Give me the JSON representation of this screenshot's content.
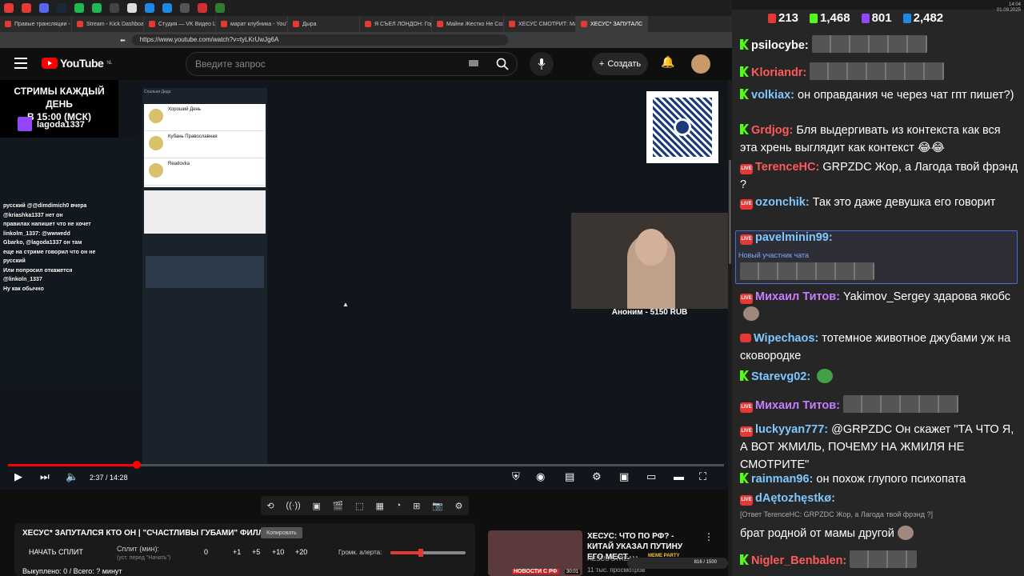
{
  "browser": {
    "tabs": [
      {
        "label": "Правые трансляции - Y",
        "active": false
      },
      {
        "label": "Stream - Kick Dashboard",
        "active": false
      },
      {
        "label": "Студия — VK Видео Live",
        "active": false
      },
      {
        "label": "марат клубника - YouTu",
        "active": false
      },
      {
        "label": "Дырa",
        "active": false
      },
      {
        "label": "Я СЪЕЛ ЛОНДОН: Гор",
        "active": false
      },
      {
        "label": "Майни Жестко Не Соз",
        "active": false
      },
      {
        "label": "ХЕСУС СМОТРИТ: Мар",
        "active": false
      },
      {
        "label": "ХЕСУС* ЗАПУТАЛС",
        "active": true
      }
    ],
    "url": "https://www.youtube.com/watch?v=tyLKrUwJg6A",
    "tray": {
      "lang": "РУС",
      "time": "14:04",
      "date": "01.09.2025"
    }
  },
  "youtube": {
    "logo": "YouTube",
    "region": "NL",
    "search_placeholder": "Введите запрос",
    "create_label": "Создать"
  },
  "stream_overlay": {
    "banner_line1": "СТРИМЫ КАЖДЫЙ ДЕНЬ",
    "banner_line2": "В 15:00 (МСК)",
    "twitch_name": "lagoda1337",
    "left_chat": [
      "русский @@dimdimich0 вчера",
      "@kriashka1337 нет он",
      "правилах напишет что не хочет",
      "linkolm_1337: @wwwedd",
      "Gbarko, @lagoda1337 он там",
      "еще на стриме говорил что он не",
      "русский",
      "Или попросил откажется",
      "@linkoln_1337",
      "Ну как обычно"
    ],
    "doc_header": "Спальни Деда",
    "doc_cards": [
      "Хороший День",
      "Кубань Православная",
      "Readovka"
    ],
    "donation": "Аноним - 5150 RUB"
  },
  "player": {
    "time_current": "2:37",
    "time_total": "14:28",
    "progress": 0.18
  },
  "below": {
    "video_title": "ХЕСУС* ЗАПУТАЛСЯ КТО ОН | \"СЧАСТЛИВЫ ГУБАМИ\" ФИЛЛЕР",
    "copy_label": "Копировать",
    "start_split": "НАЧАТЬ СПЛИТ",
    "split_label": "Сплит (мин):",
    "split_hint": "(уст. перед \"Начать\")",
    "split_values": [
      "0",
      "+1",
      "+5",
      "+10",
      "+20"
    ],
    "alert_label": "Громк. алерта:",
    "alert_level": 0.4,
    "bought": "Выкуплено: 0 / Всего: ? минут"
  },
  "recommended": {
    "title": "ХЕСУС: ЧТО ПО РФ? - КИТАЙ УКАЗАЛ ПУТИНУ ЕГО МЕСТ...",
    "channel": "HESUS STREAM",
    "meta": "11 тыс. просмотров",
    "thumb_label": "НОВОСТИ С РФ",
    "duration": "30:01",
    "meme_title": "МЕМЕ PARTY",
    "meme_value": "816 / 1500"
  },
  "chat": {
    "stats": [
      {
        "value": "213",
        "color": "#e53935"
      },
      {
        "value": "1,468",
        "color": "#53fc18"
      },
      {
        "value": "801",
        "color": "#9146ff"
      },
      {
        "value": "2,482",
        "color": "#1e88e5"
      }
    ],
    "messages": [
      {
        "platform": "kick",
        "nick": "psilocybe:",
        "color": "#ffffff",
        "text": "",
        "emotes": 6
      },
      {
        "platform": "kick",
        "nick": "Kloriandr:",
        "color": "#ff5a5a",
        "text": "",
        "emotes": 7
      },
      {
        "platform": "kick",
        "nick": "volkiax:",
        "color": "#7ec8ff",
        "text": "он оправдания че через чат гпт пишет?)"
      },
      {
        "platform": "kick",
        "nick": "Grdjog:",
        "color": "#ff5a5a",
        "text": "Бля выдергивать из контекста как вся эта хрень выглядит как контекст 😂😂"
      },
      {
        "platform": "live",
        "nick": "TerenceHC:",
        "color": "#ff5a5a",
        "text": "GRPZDC Жор, а Лагода твой фрэнд ?"
      },
      {
        "platform": "live",
        "nick": "ozonchik:",
        "color": "#7ec8ff",
        "text": "Так это даже девушка его говорит"
      },
      {
        "platform": "live",
        "nick": "pavelminin99:",
        "color": "#7ec8ff",
        "text": "",
        "sub": "Новый участник чата",
        "emotes": 7
      },
      {
        "platform": "live",
        "nick": "Михаил Титов:",
        "color": "#c77dff",
        "text": "Yakimov_Sergey здарова якобс"
      },
      {
        "platform": "yt",
        "nick": "Wipechaos:",
        "color": "#7ec8ff",
        "text": "тотемное животное джубами уж на сковородке"
      },
      {
        "platform": "kick",
        "nick": "Starevg02:",
        "color": "#7ec8ff",
        "text": ""
      },
      {
        "platform": "live",
        "nick": "Михаил Титов:",
        "color": "#c77dff",
        "text": "",
        "emotes": 6
      },
      {
        "platform": "live",
        "nick": "luckyyan777:",
        "color": "#7ec8ff",
        "text": "@GRPZDC Он скажет \"ТА ЧТО Я, А ВОТ ЖМИЛЬ, ПОЧЕМУ НА ЖМИЛЯ НЕ СМОТРИТЕ\""
      },
      {
        "platform": "kick",
        "nick": "rainman96:",
        "color": "#7ec8ff",
        "text": "он похож глупого психопата"
      },
      {
        "platform": "live",
        "nick": "dAętozhęstkø:",
        "color": "#7ec8ff",
        "text": "",
        "reply": "[Ответ TerenceHC: GRPZDC Жор, а Лагода твой фрэнд ?]"
      },
      {
        "platform": "none",
        "nick": "",
        "color": "#ffffff",
        "text": "брат родной от мамы другой"
      },
      {
        "platform": "kick",
        "nick": "Nigler_Benbalen:",
        "color": "#ff5a5a",
        "text": ""
      }
    ]
  }
}
